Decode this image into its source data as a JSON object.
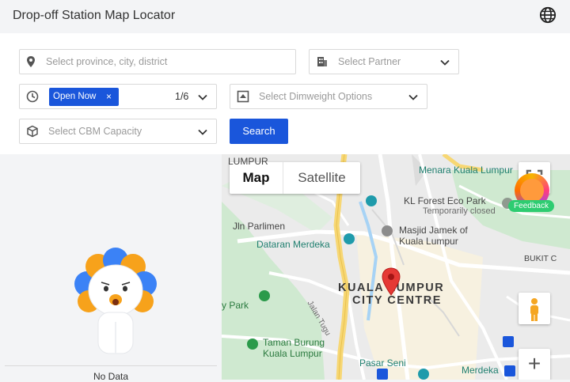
{
  "header": {
    "title": "Drop-off Station Map Locator",
    "language_icon": "globe-icon"
  },
  "filters": {
    "location": {
      "placeholder": "Select province, city, district",
      "icon": "location-pin-icon"
    },
    "partner": {
      "placeholder": "Select Partner",
      "icon": "building-icon"
    },
    "hours": {
      "icon": "clock-icon",
      "selected_tag": "Open Now",
      "tag_close": "×",
      "count": "1/6"
    },
    "dimweight": {
      "placeholder": "Select Dimweight Options",
      "icon": "scale-icon"
    },
    "cbm": {
      "placeholder": "Select CBM Capacity",
      "icon": "box-icon"
    },
    "search_label": "Search"
  },
  "results": {
    "empty_text": "No Data"
  },
  "map": {
    "type_map": "Map",
    "type_satellite": "Satellite",
    "feedback_label": "Feedback",
    "labels": {
      "lumpur_top": "LUMPUR",
      "menara": "Menara Kuala Lumpur",
      "kl_forest": "KL Forest Eco Park",
      "temp_closed": "Temporarily closed",
      "jln_parlimen": "Jln Parlimen",
      "masjid_1": "Masjid Jamek of",
      "masjid_2": "Kuala Lumpur",
      "dataran": "Dataran Merdeka",
      "bukit": "BUKIT C",
      "klcc_1": "KUALA LUMPUR",
      "klcc_2": "CITY CENTRE",
      "park": "y Park",
      "jalan_tugu": "Jalan Tugu",
      "taman_1": "Taman Burung",
      "taman_2": "Kuala Lumpur",
      "pasar": "Pasar Seni",
      "merdeka": "Merdeka"
    },
    "zoom_in": "+",
    "colors": {
      "pin": "#e53935",
      "road_major": "#f7d774",
      "park": "#cdeccf"
    }
  }
}
